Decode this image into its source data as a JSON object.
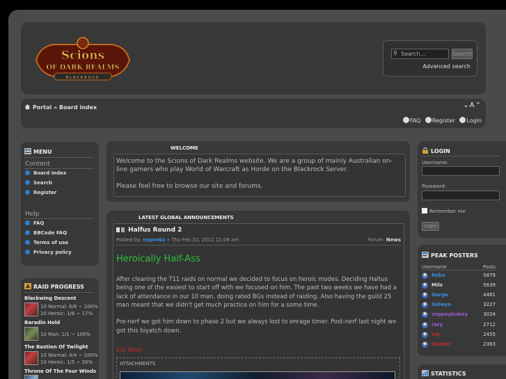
{
  "header": {
    "logo": {
      "line1": "Scions",
      "line2": "OF DARK REALMS",
      "line3": "BLACKROCK"
    },
    "search": {
      "placeholder": "Search…",
      "button_label": "Search",
      "advanced_label": "Advanced search"
    }
  },
  "navbar": {
    "breadcrumb": "Portal « Board index",
    "font_controls": "⌄A⌃",
    "links": {
      "faq": "FAQ",
      "register": "Register",
      "login": "Login"
    }
  },
  "menu": {
    "title": "MENU",
    "content_heading": "Content",
    "content_items": [
      "Board index",
      "Search",
      "Register"
    ],
    "help_heading": "Help",
    "help_items": [
      "FAQ",
      "BBCode FAQ",
      "Terms of use",
      "Privacy policy"
    ]
  },
  "raid_progress": {
    "title": "RAID PROGRESS",
    "raids": [
      {
        "name": "Blackwing Descent",
        "lines": [
          "10 Normal: 6/6 ~ 100%",
          "10 Heroic: 1/6 ~ 17%"
        ]
      },
      {
        "name": "Baradin Hold",
        "lines": [
          "10 Man: 1/1 ~ 100%"
        ]
      },
      {
        "name": "The Bastion Of Twilight",
        "lines": [
          "10 Normal: 4/4 ~ 100%",
          "10 Heroic: 1/5 ~ 20%"
        ]
      },
      {
        "name": "Throne Of The Four Winds",
        "lines": []
      }
    ]
  },
  "welcome": {
    "title": "WELCOME",
    "text": "Welcome to the Scions of Dark Realms website. We are a group of mainly Australian on-line gamers who play World of Warcraft as Horde on the Blackrock Server.",
    "text2": "Please feel free to browse our site and forums."
  },
  "announcements": {
    "title": "LATEST GLOBAL ANNOUNCEMENTS",
    "post": {
      "title": "Halfus Round 2",
      "posted_by_prefix": "Posted by:",
      "author": "noprobz",
      "date": "» Thu Feb 10, 2011 11:08 am",
      "forum_prefix": "Forum:",
      "forum": "News",
      "heading": "Heroically Half-Ass",
      "paragraph1": "After clearing the T11 raids on normal we decided to focus on heroic modes. Deciding Haltus being one of the easiest to start off with we focused on him. The past two weeks we have had a lack of attendance in our 10 man, doing rated BGs instead of raiding. Also having the guild 25 man meant that we didn't get much practice on him for a some time.",
      "paragraph2": "Pre-nerf we got him down to phase 2 but we always lost to enrage timer. Post-nerf last night we got this biyatch down.",
      "kill_shot": "Kill Shot",
      "attachments_label": "ATTACHMENTS"
    }
  },
  "login": {
    "title": "LOGIN",
    "username_label": "Username:",
    "password_label": "Password:",
    "remember_label": "Remember me",
    "button_label": "Login"
  },
  "peak_posters": {
    "title": "PEAK POSTERS",
    "col_username": "Username",
    "col_posts": "Posts",
    "rows": [
      {
        "name": "Rebo",
        "posts": "5879",
        "color": "#3a8fe0"
      },
      {
        "name": "Mils",
        "posts": "5639",
        "color": "#dddddd"
      },
      {
        "name": "Garga",
        "posts": "4481",
        "color": "#3a8fe0"
      },
      {
        "name": "Selwyn",
        "posts": "3227",
        "color": "#3a8fe0"
      },
      {
        "name": "zeppeybabey",
        "posts": "3024",
        "color": "#9b59d0"
      },
      {
        "name": "rary",
        "posts": "2712",
        "color": "#9b59d0"
      },
      {
        "name": "Ish",
        "posts": "2455",
        "color": "#c62b2b"
      },
      {
        "name": "Snaker",
        "posts": "2363",
        "color": "#c62b2b"
      }
    ]
  },
  "statistics": {
    "title": "STATISTICS"
  },
  "colors": {
    "accent_blue": "#3a8fe0",
    "heading_green": "#2fbf3a",
    "kill_red": "#c62b2b",
    "panel": "#383838",
    "frame": "#4a4a4a"
  }
}
